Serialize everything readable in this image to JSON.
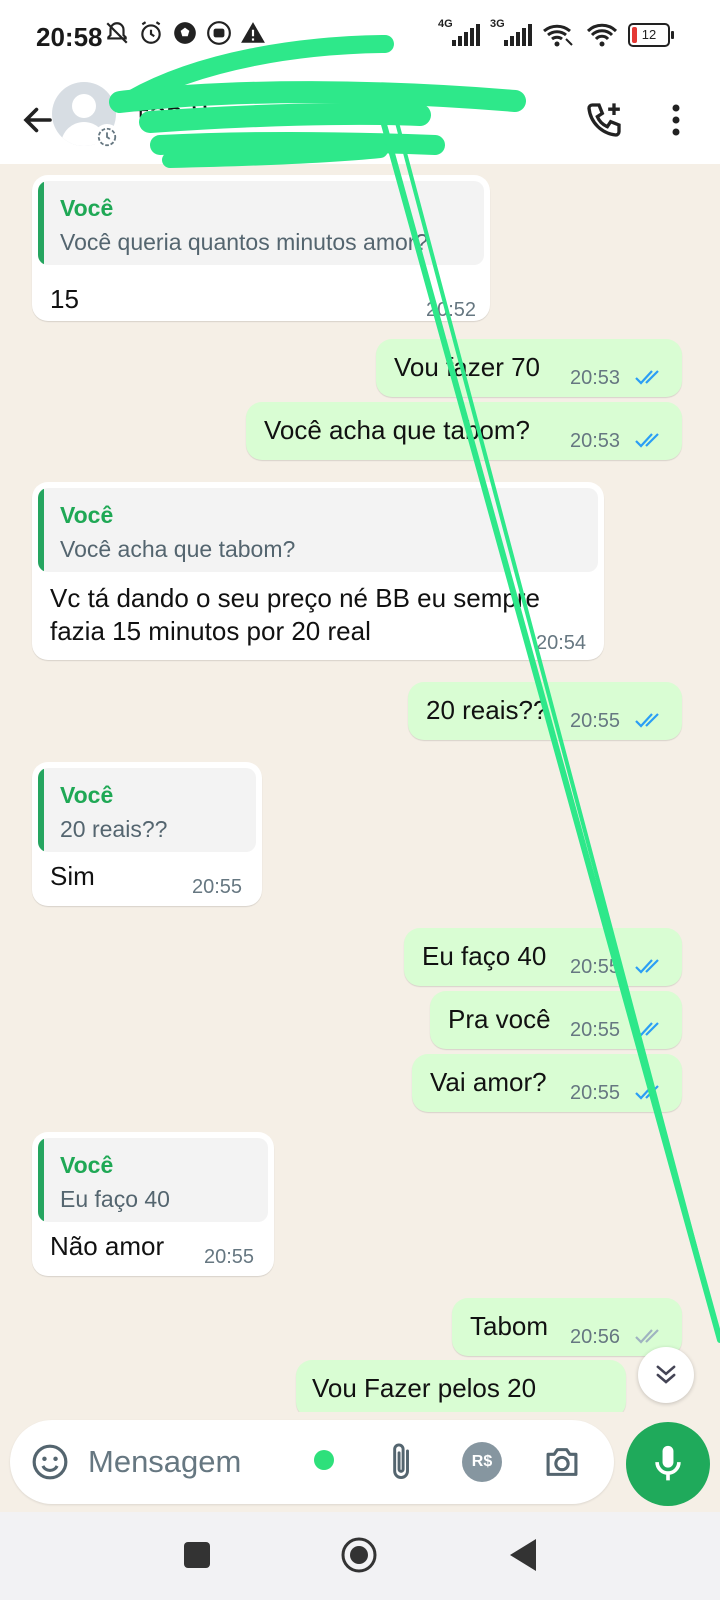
{
  "status_bar": {
    "time": "20:58",
    "signal1_tag": "4G",
    "signal2_tag": "3G",
    "battery": "12",
    "icons": [
      "mute-bell-icon",
      "alarm-icon",
      "soccer-ball-icon",
      "camera-app-icon",
      "warning-icon",
      "wifi-calling-icon",
      "wifi-icon"
    ]
  },
  "header": {
    "contact": "+55 9",
    "icons": [
      "back-arrow-icon",
      "avatar",
      "disappearing-timer-icon",
      "add-call-icon",
      "more-vert-icon"
    ]
  },
  "messages": [
    {
      "dir": "in",
      "quote_name": "Você",
      "quote_text": "Você queria quantos minutos amor?",
      "text": "15",
      "time": "20:52"
    },
    {
      "dir": "out",
      "text": "Vou fazer 70",
      "time": "20:53",
      "status": "read"
    },
    {
      "dir": "out",
      "text": "Você acha que tabom?",
      "time": "20:53",
      "status": "read"
    },
    {
      "dir": "in",
      "quote_name": "Você",
      "quote_text": "Você acha que tabom?",
      "text_line1": "Vc tá dando o seu preço né BB eu sempre",
      "text_line2": "fazia 15 minutos por 20 real",
      "time": "20:54"
    },
    {
      "dir": "out",
      "text": "20 reais??",
      "time": "20:55",
      "status": "read"
    },
    {
      "dir": "in",
      "quote_name": "Você",
      "quote_text": "20 reais??",
      "text": "Sim",
      "time": "20:55"
    },
    {
      "dir": "out",
      "text": "Eu faço 40",
      "time": "20:55",
      "status": "read"
    },
    {
      "dir": "out",
      "text": "Pra você",
      "time": "20:55",
      "status": "read"
    },
    {
      "dir": "out",
      "text": "Vai amor?",
      "time": "20:55",
      "status": "read"
    },
    {
      "dir": "in",
      "quote_name": "Você",
      "quote_text": "Eu faço 40",
      "text": "Não amor",
      "time": "20:55"
    },
    {
      "dir": "out",
      "text": "Tabom",
      "time": "20:56",
      "status": "delivered"
    },
    {
      "dir": "out",
      "text": "Vou Fazer pelos 20",
      "time": "",
      "status": ""
    }
  ],
  "composer": {
    "placeholder": "Mensagem",
    "pay_label": "R$"
  },
  "colors": {
    "accent_green": "#1fa855",
    "outgoing_bubble": "#d9fdd3",
    "chat_bg": "#f5efe6",
    "read_ticks": "#2b9ef5",
    "scribble": "#2ee88a"
  }
}
